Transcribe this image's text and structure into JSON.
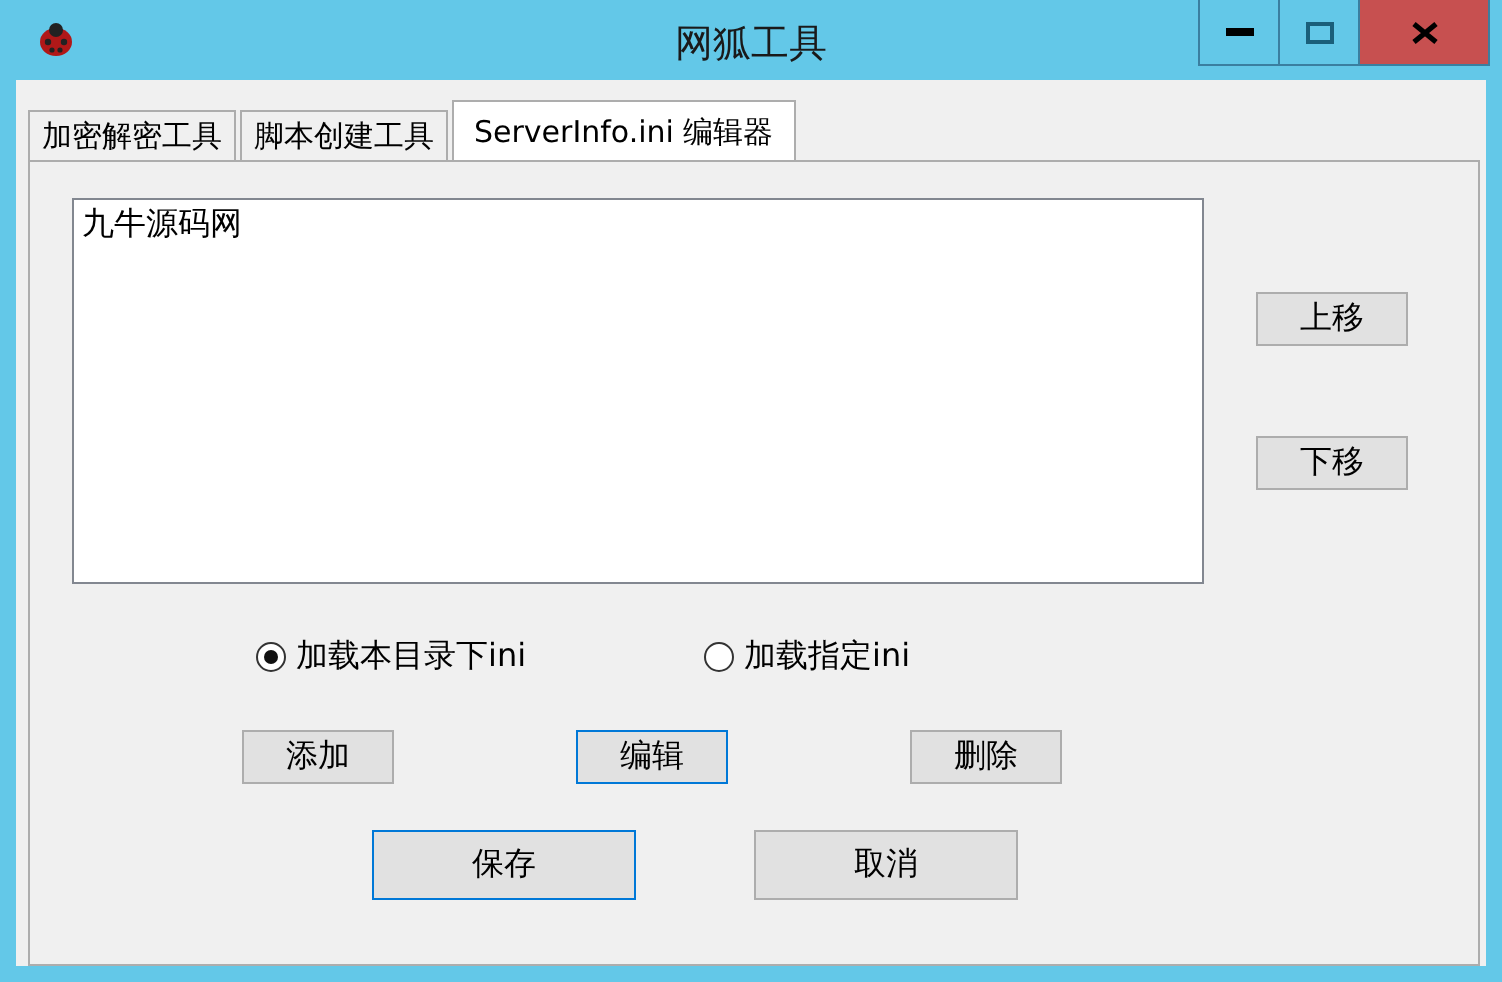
{
  "window": {
    "title": "网狐工具"
  },
  "tabs": [
    {
      "label": "加密解密工具",
      "selected": false
    },
    {
      "label": "脚本创建工具",
      "selected": false
    },
    {
      "label": "ServerInfo.ini 编辑器",
      "selected": true
    }
  ],
  "list": {
    "items": [
      {
        "label": "九牛源码网",
        "selected": false
      }
    ]
  },
  "side_buttons": [
    {
      "label": "上移",
      "focused": false
    },
    {
      "label": "下移",
      "focused": false
    }
  ],
  "radios": [
    {
      "label": "加载本目录下ini",
      "selected": true
    },
    {
      "label": "加载指定ini",
      "selected": false
    }
  ],
  "action_buttons": [
    {
      "label": "添加",
      "focused": false
    },
    {
      "label": "编辑",
      "focused": true
    },
    {
      "label": "删除",
      "focused": false
    }
  ],
  "bottom_buttons": [
    {
      "label": "保存",
      "focused": true
    },
    {
      "label": "取消",
      "focused": false
    }
  ]
}
